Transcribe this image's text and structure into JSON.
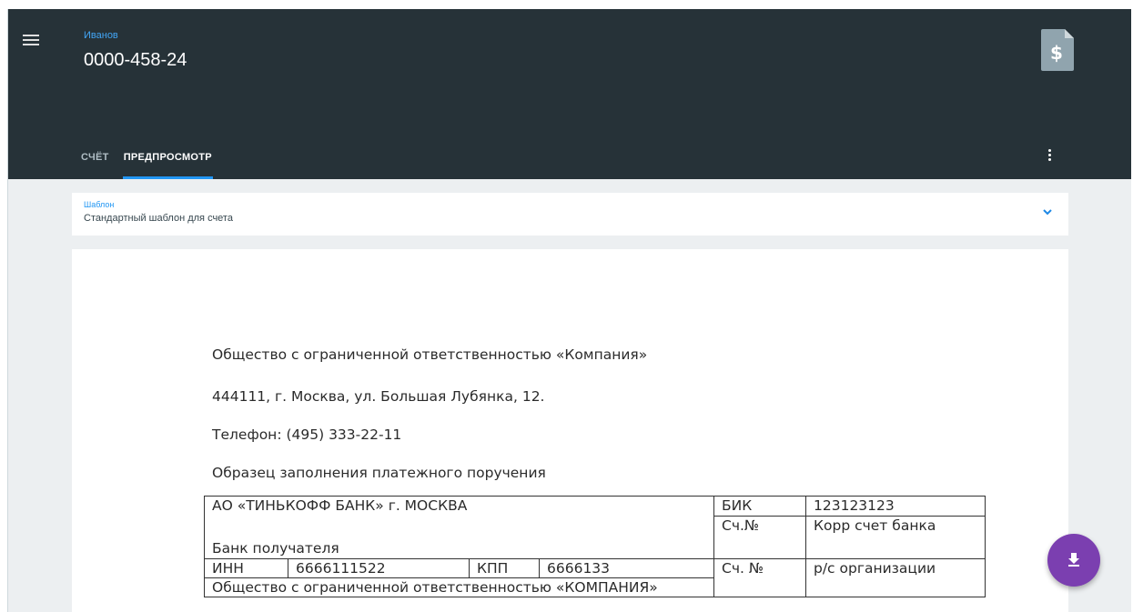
{
  "header": {
    "subtitle": "Иванов",
    "title": "0000-458-24",
    "icons": {
      "menu": "menu-icon",
      "document": "invoice-document-icon",
      "more": "more-vert-icon"
    }
  },
  "tabs": [
    {
      "label": "СЧЁТ",
      "active": false
    },
    {
      "label": "ПРЕДПРОСМОТР",
      "active": true
    }
  ],
  "template_select": {
    "label": "Шаблон",
    "value": "Стандартный шаблон для счета"
  },
  "document": {
    "company": "Общество с ограниченной ответственностью «Компания»",
    "address": "444111, г. Москва, ул. Большая Лубянка, 12.",
    "phone": "Телефон: (495) 333-22-11",
    "sample_title": "Образец заполнения платежного поручения",
    "table": {
      "bank_name": "АО «ТИНЬКОФФ БАНК» г. МОСКВА",
      "bank_caption": "Банк получателя",
      "bik_label": "БИК",
      "bik_value": "123123123",
      "corr_label": "Сч.№",
      "corr_value": "Корр счет банка",
      "inn_label": "ИНН",
      "inn_value": "6666111522",
      "kpp_label": "КПП",
      "kpp_value": "6666133",
      "account_label": "Сч. №",
      "account_value": "р/с организации",
      "recipient": "Общество с ограниченной ответственностью «КОМПАНИЯ»"
    }
  },
  "fab": {
    "icon": "download-icon"
  },
  "colors": {
    "appbar": "#263238",
    "accent": "#2196f3",
    "fab": "#7b3fb0",
    "background": "#eceff1"
  }
}
